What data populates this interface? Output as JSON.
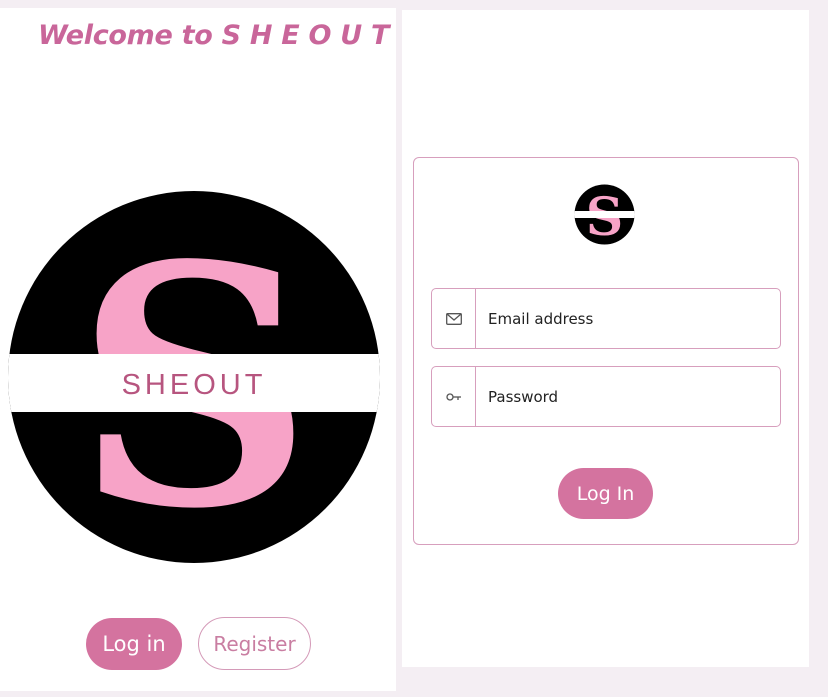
{
  "left_screen": {
    "welcome_text": "Welcome to S H E O U T",
    "logo": {
      "letter": "S",
      "band_text": "SHEOUT",
      "circle_color": "#000000",
      "letter_color": "#f7a3c7",
      "band_text_color": "#b7557f"
    },
    "buttons": {
      "login_label": "Log in",
      "register_label": "Register"
    }
  },
  "right_screen": {
    "logo": {
      "letter": "S"
    },
    "email": {
      "placeholder": "Email address",
      "icon": "envelope-icon"
    },
    "password": {
      "placeholder": "Password",
      "icon": "key-icon"
    },
    "login_button_label": "Log In"
  },
  "colors": {
    "accent_pink": "#d4739f",
    "border_pink": "#d79fbd",
    "title_pink": "#c9669a"
  }
}
